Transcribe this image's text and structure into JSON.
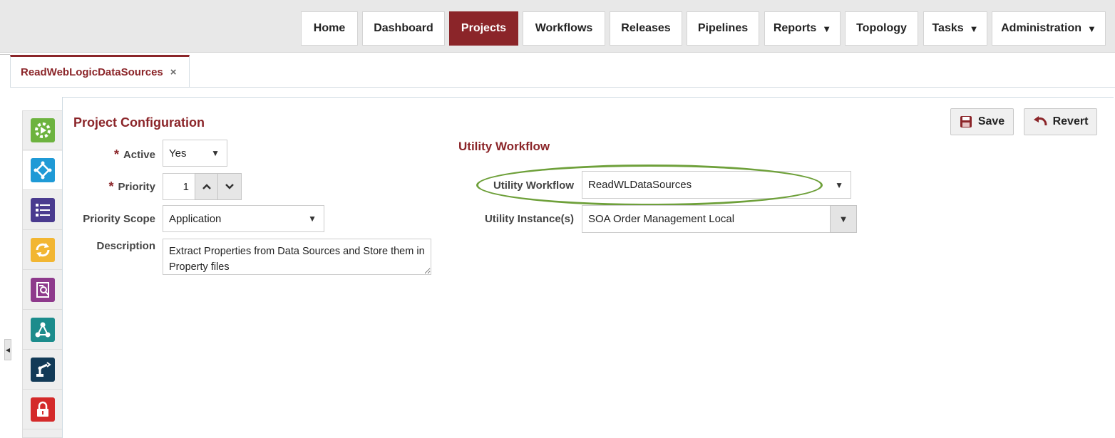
{
  "nav": {
    "items": [
      {
        "label": "Home",
        "active": false,
        "has_dropdown": false
      },
      {
        "label": "Dashboard",
        "active": false,
        "has_dropdown": false
      },
      {
        "label": "Projects",
        "active": true,
        "has_dropdown": false
      },
      {
        "label": "Workflows",
        "active": false,
        "has_dropdown": false
      },
      {
        "label": "Releases",
        "active": false,
        "has_dropdown": false
      },
      {
        "label": "Pipelines",
        "active": false,
        "has_dropdown": false
      },
      {
        "label": "Reports",
        "active": false,
        "has_dropdown": true
      },
      {
        "label": "Topology",
        "active": false,
        "has_dropdown": false
      },
      {
        "label": "Tasks",
        "active": false,
        "has_dropdown": true
      },
      {
        "label": "Administration",
        "active": false,
        "has_dropdown": true
      }
    ],
    "caret_glyph": "▼"
  },
  "tab": {
    "title": "ReadWebLogicDataSources",
    "close_glyph": "×"
  },
  "sidebar": {
    "icons": [
      {
        "name": "deploy-gear-icon",
        "color": "#6db33f",
        "active": false
      },
      {
        "name": "workflow-icon",
        "color": "#1f9ad6",
        "active": true
      },
      {
        "name": "list-icon",
        "color": "#4a3b8f",
        "active": false
      },
      {
        "name": "refresh-icon",
        "color": "#f2b632",
        "active": false
      },
      {
        "name": "report-icon",
        "color": "#8e3a8c",
        "active": false
      },
      {
        "name": "topology-icon",
        "color": "#1c8c8c",
        "active": false
      },
      {
        "name": "robot-arm-icon",
        "color": "#123a57",
        "active": false
      },
      {
        "name": "lock-icon",
        "color": "#d42a2a",
        "active": false
      }
    ]
  },
  "project_config": {
    "title": "Project Configuration",
    "required_mark": "*",
    "active_label": "Active",
    "active_value": "Yes",
    "priority_label": "Priority",
    "priority_value": "1",
    "priority_scope_label": "Priority Scope",
    "priority_scope_value": "Application",
    "description_label": "Description",
    "description_value": "Extract Properties from Data Sources and Store them in Property files"
  },
  "utility": {
    "title": "Utility Workflow",
    "workflow_label": "Utility Workflow",
    "workflow_value": "ReadWLDataSources",
    "instances_label": "Utility Instance(s)",
    "instances_value": "SOA Order Management Local"
  },
  "actions": {
    "save_label": "Save",
    "revert_label": "Revert"
  },
  "colors": {
    "brand": "#8b2529",
    "highlight": "#6ea03a"
  }
}
